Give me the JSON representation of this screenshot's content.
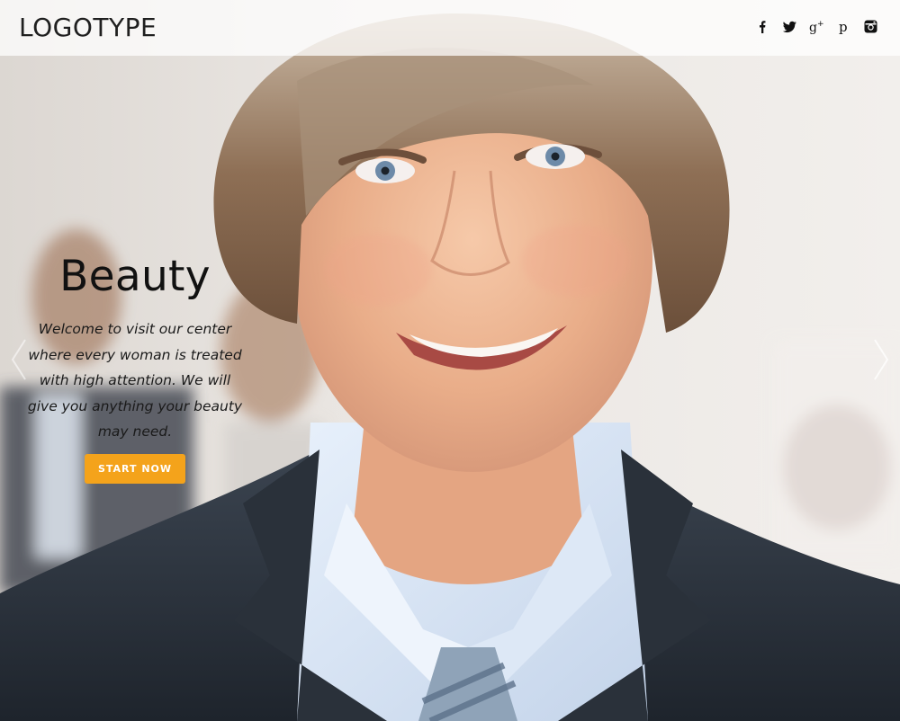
{
  "header": {
    "logo": "LOGOTYPE",
    "social": [
      {
        "icon": "facebook-icon",
        "glyph": "f"
      },
      {
        "icon": "twitter-icon",
        "glyph": "t"
      },
      {
        "icon": "google-plus-icon",
        "glyph": "g+"
      },
      {
        "icon": "pinterest-icon",
        "glyph": "p"
      },
      {
        "icon": "instagram-icon",
        "glyph": "ig"
      }
    ]
  },
  "slider": {
    "title": "Beauty",
    "text": "Welcome to visit our center where every woman is treated with high attention. We will give you anything your beauty may need.",
    "button_label": "START NOW",
    "prev_icon": "chevron-left-icon",
    "next_icon": "chevron-right-icon"
  },
  "colors": {
    "accent": "#f4a31b",
    "header_bg": "rgba(255,255,255,0.74)",
    "text": "#111111"
  }
}
